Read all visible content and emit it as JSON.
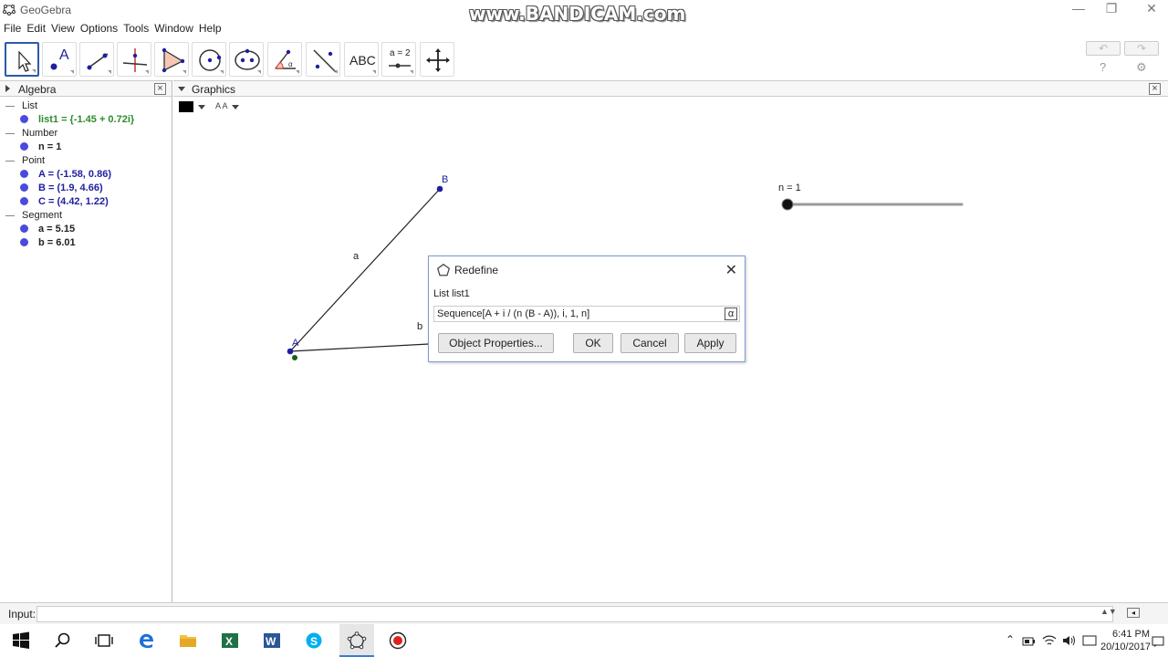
{
  "window": {
    "title": "GeoGebra",
    "watermark": "www.BANDICAM.com",
    "minimize_label": "—",
    "restore_label": "❐",
    "close_label": "✕"
  },
  "menu": [
    "File",
    "Edit",
    "View",
    "Options",
    "Tools",
    "Window",
    "Help"
  ],
  "toolbar": {
    "tools": [
      {
        "name": "move-tool",
        "icon": "arrow-cursor-icon"
      },
      {
        "name": "point-tool",
        "icon": "point-icon",
        "text": "A"
      },
      {
        "name": "line-tool",
        "icon": "line-icon"
      },
      {
        "name": "perpendicular-tool",
        "icon": "perpendicular-icon"
      },
      {
        "name": "polygon-tool",
        "icon": "polygon-icon"
      },
      {
        "name": "circle-tool",
        "icon": "circle-icon"
      },
      {
        "name": "conic-tool",
        "icon": "ellipse-icon"
      },
      {
        "name": "angle-tool",
        "icon": "angle-icon"
      },
      {
        "name": "reflect-tool",
        "icon": "reflect-icon"
      },
      {
        "name": "text-tool",
        "icon": "text-icon",
        "text": "ABC"
      },
      {
        "name": "slider-tool",
        "icon": "slider-icon",
        "text": "a = 2"
      },
      {
        "name": "move-graphics-tool",
        "icon": "move-cross-icon"
      }
    ],
    "undo_label": "↶",
    "redo_label": "↷",
    "help_label": "?",
    "settings_label": "⚙"
  },
  "algebra": {
    "title": "Algebra",
    "close_label": "×",
    "groups": [
      {
        "category": "List",
        "items": [
          {
            "text": "list1 = {-1.45 + 0.72i}",
            "color": "#2e8b2e"
          }
        ]
      },
      {
        "category": "Number",
        "items": [
          {
            "text": "n = 1",
            "color": "#222222"
          }
        ]
      },
      {
        "category": "Point",
        "items": [
          {
            "text": "A = (-1.58, 0.86)",
            "color": "#1f1f9e"
          },
          {
            "text": "B = (1.9, 4.66)",
            "color": "#1f1f9e"
          },
          {
            "text": "C = (4.42, 1.22)",
            "color": "#1f1f9e"
          }
        ]
      },
      {
        "category": "Segment",
        "items": [
          {
            "text": "a = 5.15",
            "color": "#222222"
          },
          {
            "text": "b = 6.01",
            "color": "#222222"
          }
        ]
      }
    ]
  },
  "graphics": {
    "title": "Graphics",
    "close_label": "×",
    "font_size_label": "A A",
    "point_labels": {
      "A": "A",
      "B": "B"
    },
    "segment_labels": {
      "a": "a",
      "b": "b"
    },
    "slider_label": "n = 1"
  },
  "dialog": {
    "title": "Redefine",
    "close_label": "✕",
    "object_label": "List list1",
    "input_value": "Sequence[A + i / (n (B - A)), i, 1, n]",
    "alpha_label": "α",
    "buttons": {
      "object_properties": "Object Properties...",
      "ok": "OK",
      "cancel": "Cancel",
      "apply": "Apply"
    }
  },
  "inputbar": {
    "label": "Input:",
    "value": "",
    "spinner_label": "▲▼"
  },
  "taskbar": {
    "time": "6:41 PM",
    "date": "20/10/2017"
  },
  "colors": {
    "accent": "#2d5aa7",
    "point": "#1f1f9e",
    "list": "#2e8b2e"
  }
}
